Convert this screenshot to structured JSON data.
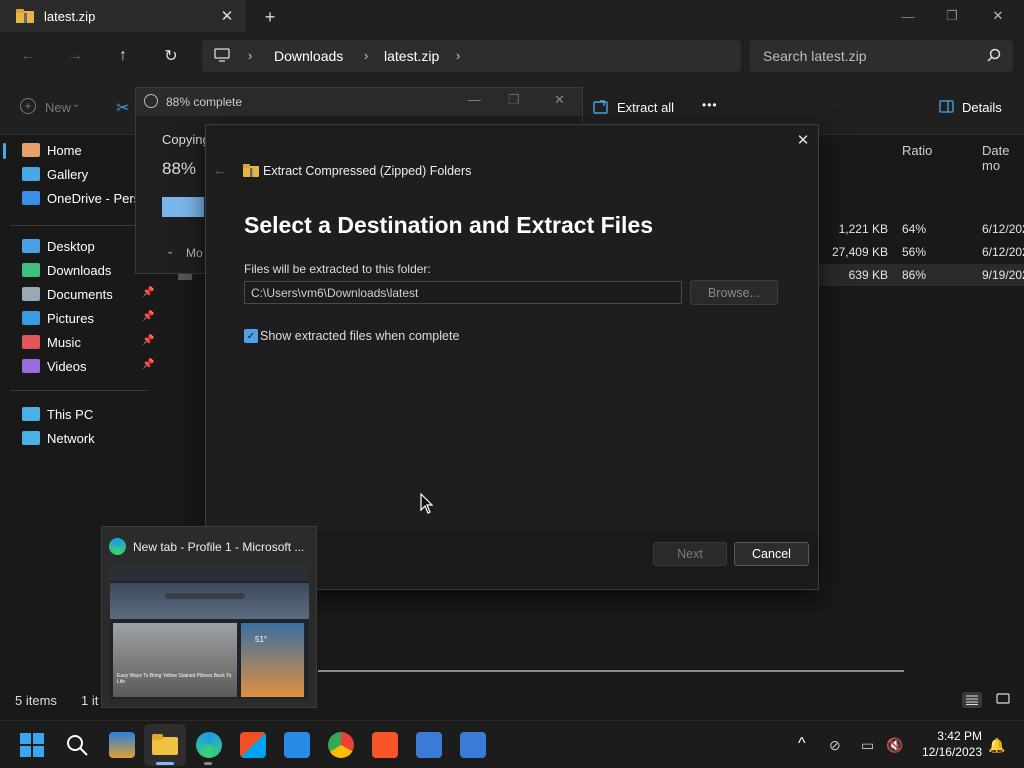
{
  "window": {
    "tab_title": "latest.zip",
    "new_tab_symbol": "+",
    "close_symbol": "✕",
    "min_symbol": "—",
    "max_symbol": "❐"
  },
  "nav": {
    "back_symbol": "←",
    "forward_symbol": "→",
    "up_symbol": "↑",
    "refresh_symbol": "↻",
    "breadcrumb": [
      "Downloads",
      "latest.zip"
    ],
    "search_placeholder": "Search latest.zip"
  },
  "commands": {
    "new_label": "New",
    "extract_all_label": "Extract all",
    "more_symbol": "•••",
    "details_label": "Details"
  },
  "sidebar": {
    "items": [
      {
        "label": "Home",
        "icon": "home-icon",
        "color": "#e8a06b"
      },
      {
        "label": "Gallery",
        "icon": "gallery-icon",
        "color": "#4aa8e6"
      },
      {
        "label": "OneDrive - Perso",
        "icon": "cloud-icon",
        "color": "#3a8ee6"
      },
      {
        "label": "Desktop",
        "icon": "desktop-icon",
        "color": "#4aa0e6"
      },
      {
        "label": "Downloads",
        "icon": "download-icon",
        "color": "#3fbf7f"
      },
      {
        "label": "Documents",
        "icon": "documents-icon",
        "color": "#9aa9b8"
      },
      {
        "label": "Pictures",
        "icon": "pictures-icon",
        "color": "#3b9be0"
      },
      {
        "label": "Music",
        "icon": "music-icon",
        "color": "#e0565a"
      },
      {
        "label": "Videos",
        "icon": "videos-icon",
        "color": "#9b6be0"
      },
      {
        "label": "This PC",
        "icon": "pc-icon",
        "color": "#4ab0e6"
      },
      {
        "label": "Network",
        "icon": "network-icon",
        "color": "#4ab0e6"
      }
    ],
    "pin_symbol": "📌"
  },
  "table": {
    "headers": {
      "ratio": "Ratio",
      "date": "Date mo"
    },
    "rows": [
      {
        "size": "1,221 KB",
        "ratio": "64%",
        "date": "6/12/202"
      },
      {
        "size": "27,409 KB",
        "ratio": "56%",
        "date": "6/12/202"
      },
      {
        "size": "639 KB",
        "ratio": "86%",
        "date": "9/19/202"
      }
    ]
  },
  "progress_window": {
    "title": "88% complete",
    "copying_label": "Copying",
    "percent": "88%",
    "progress_fraction": 0.88,
    "more_label": "Mo"
  },
  "dialog": {
    "header_title": "Extract Compressed (Zipped) Folders",
    "heading": "Select a Destination and Extract Files",
    "path_label": "Files will be extracted to this folder:",
    "path_value": "C:\\Users\\vm6\\Downloads\\latest",
    "browse_label": "Browse...",
    "checkbox_label": "Show extracted files when complete",
    "checkbox_checked": true,
    "next_label": "Next",
    "cancel_label": "Cancel"
  },
  "statusbar": {
    "items_count": "5 items",
    "selected": "1 it"
  },
  "thumbnail": {
    "title": "New tab - Profile 1 - Microsoft ...",
    "temp": "51°",
    "headline": "Easy Ways To Bring Yellow Stained Pillows Back To Life"
  },
  "taskbar": {
    "time": "3:42 PM",
    "date": "12/16/2023",
    "chevron_symbol": "^"
  }
}
